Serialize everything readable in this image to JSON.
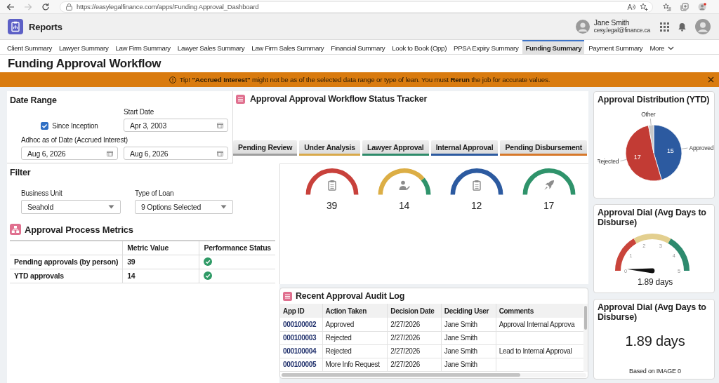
{
  "browser": {
    "url": "https://easylegalfinance.com/apps/Funding Approval_Dashboard"
  },
  "app_header": {
    "title": "Reports",
    "user": {
      "name": "Jane Smith",
      "email": "cesy.legal@finance.ca"
    }
  },
  "nav_tabs": [
    {
      "label": "Client Summary",
      "selected": false
    },
    {
      "label": "Lawyer Summary",
      "selected": false
    },
    {
      "label": "Law Firm Summary",
      "selected": false
    },
    {
      "label": "Lawyer Sales Summary",
      "selected": false
    },
    {
      "label": "Law Firm Sales Summary",
      "selected": false
    },
    {
      "label": "Financial Summary",
      "selected": false
    },
    {
      "label": "Look to Book (Opp)",
      "selected": false
    },
    {
      "label": "PPSA Expiry Summary",
      "selected": false
    },
    {
      "label": "Funding Summary",
      "selected": true
    },
    {
      "label": "Payment Summary",
      "selected": false
    }
  ],
  "more_menu": {
    "label": "More"
  },
  "page_title": "Funding Approval Workflow",
  "banner": {
    "text": "Tip! **\"Accrued Interest\"** might not be as of the selected data range or type of lean. You must **Rerun** the job for accurate values."
  },
  "date_range": {
    "title": "Date Range",
    "since_inception": {
      "label": "Since Inception",
      "checked": true
    },
    "start_date": {
      "label": "Start Date",
      "value": "Apr 3, 2003"
    },
    "adhoc_date": {
      "label": "Adhoc as of Date (Accrued Interest)",
      "value": "Aug 6, 2026"
    },
    "end_date": {
      "value": "Aug 6, 2026"
    }
  },
  "filter": {
    "title": "Filter",
    "fields": [
      {
        "label": "Business Unit",
        "value": "Seahold"
      },
      {
        "label": "Type of Loan",
        "value": "9 Options Selected"
      }
    ]
  },
  "metrics": {
    "title": "Approval Process Metrics",
    "columns": [
      "Metric Value",
      "Performance Status"
    ],
    "rows": [
      {
        "metric": "Pending approvals (by person)",
        "value": "39",
        "on_track": true
      },
      {
        "metric": "YTD approvals",
        "value": "14",
        "on_track": true
      }
    ]
  },
  "tracker": {
    "title": "Approval Approval Workflow Status Tracker",
    "stages": [
      {
        "label": "Pending Review",
        "color": "#9e9e9e"
      },
      {
        "label": "Under Analysis",
        "color": "#d8a94a"
      },
      {
        "label": "Lawyer Approval",
        "color": "#2e8b6a"
      },
      {
        "label": "Internal Approval",
        "color": "#2c5aa0"
      },
      {
        "label": "Pending Disbursement",
        "color": "#d7782a"
      }
    ],
    "gauges": [
      {
        "value": "39",
        "kind": "clipboard",
        "segments": [
          {
            "color": "#c8413b"
          }
        ]
      },
      {
        "value": "14",
        "kind": "person-check",
        "segments": [
          {
            "color": "#dcae45"
          },
          {
            "color": "#2f936b"
          }
        ]
      },
      {
        "value": "12",
        "kind": "clipboard",
        "segments": [
          {
            "color": "#2c5aa0"
          }
        ]
      },
      {
        "value": "17",
        "kind": "rocket",
        "segments": [
          {
            "color": "#2f936b"
          }
        ]
      }
    ]
  },
  "audit_log": {
    "title": "Recent Approval Audit Log",
    "columns": [
      "App ID",
      "Action Taken",
      "Decision Date",
      "Deciding User",
      "Comments"
    ],
    "rows": [
      {
        "app_id": "000100002",
        "action": "Approved",
        "date": "2/27/2026",
        "user": "Jane Smith",
        "comments": "Approval Internal Approva"
      },
      {
        "app_id": "000100003",
        "action": "Rejected",
        "date": "2/27/2026",
        "user": "Jane Smith"
      },
      {
        "app_id": "000100004",
        "action": "Rejected",
        "date": "2/27/2026",
        "user": "Jane Smith",
        "comments": "Lead to Internal Approval"
      },
      {
        "app_id": "000100005",
        "action": "More Info Request",
        "date": "2/27/2026",
        "user": "Jane Smith"
      }
    ]
  },
  "distribution": {
    "chart_data": {
      "type": "pie",
      "title": "Approval Distribution (YTD)",
      "categories": [
        "Approved",
        "Rejected",
        "Other"
      ],
      "values": [
        15,
        17,
        1
      ],
      "value_labels": [
        "15",
        "17",
        null
      ]
    }
  },
  "dial": {
    "title": "Approval Dial (Avg Days to Disburse)",
    "ticks": [
      "0",
      "1",
      "2",
      "3",
      "4",
      "5"
    ],
    "level": 0.02,
    "reading": "1.89 days"
  },
  "dial_summary": {
    "title": "Approval Dial (Avg Days to Disburse)",
    "value": "1.89 days",
    "note": "Based on IMAGE 0"
  }
}
